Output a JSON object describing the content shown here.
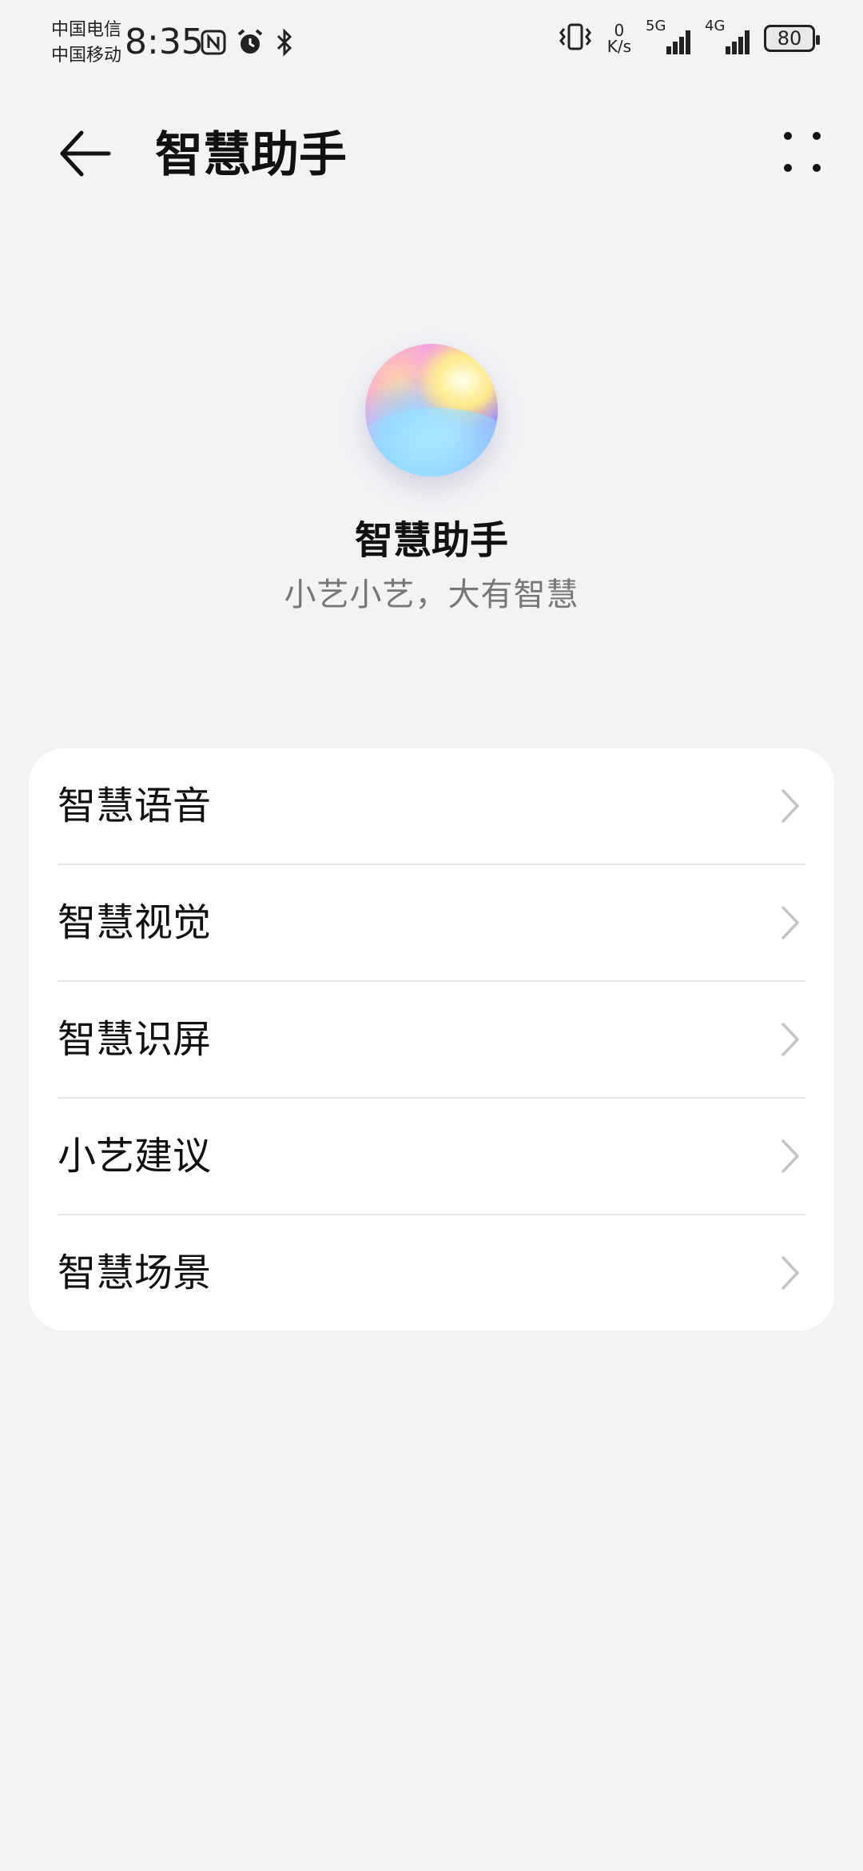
{
  "status_bar": {
    "carrier_1": "中国电信",
    "carrier_2": "中国移动",
    "time": "8:35",
    "net_speed_value": "0",
    "net_speed_unit": "K/s",
    "signal_1_label": "5G",
    "signal_2_label": "4G",
    "battery": "80",
    "icons": [
      "nfc-icon",
      "alarm-icon",
      "bluetooth-icon",
      "vibrate-icon"
    ]
  },
  "app_bar": {
    "title": "智慧助手",
    "back_icon": "back-arrow-icon",
    "more_icon": "more-icon"
  },
  "hero": {
    "title": "智慧助手",
    "subtitle": "小艺小艺，大有智慧"
  },
  "menu": {
    "items": [
      {
        "label": "智慧语音"
      },
      {
        "label": "智慧视觉"
      },
      {
        "label": "智慧识屏"
      },
      {
        "label": "小艺建议"
      },
      {
        "label": "智慧场景"
      }
    ]
  }
}
